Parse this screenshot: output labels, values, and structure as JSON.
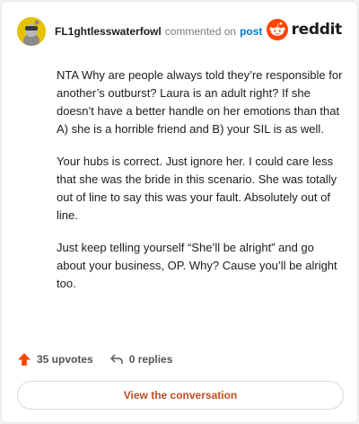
{
  "comment": {
    "username": "FL1ghtlesswaterfowl",
    "action_text": "commented on",
    "post_link": "post",
    "paragraphs": [
      "NTA Why are people always told they’re responsible for another’s outburst? Laura is an adult right? If she doesn’t have a better handle on her emotions than that A) she is a horrible friend and B) your SIL is as well.",
      "Your hubs is correct. Just ignore her. I could care less that she was the bride in this scenario. She was totally out of line to say this was your fault. Absolutely out of line.",
      "Just keep telling yourself “She’ll be alright” and go about your business, OP. Why? Cause you’ll be alright too."
    ],
    "upvotes": "35 upvotes",
    "replies": "0 replies"
  },
  "brand": {
    "wordmark": "reddit",
    "color": "#ff4500"
  },
  "footer": {
    "view_label": "View the conversation"
  },
  "colors": {
    "upvote": "#ff4500",
    "link": "#0079d3",
    "button_text": "#c14d1f"
  },
  "icons": {
    "upvote": "arrow-up-icon",
    "reply": "reply-arrow-icon",
    "logo": "reddit-snoo-icon",
    "avatar": "avatar-icon"
  }
}
